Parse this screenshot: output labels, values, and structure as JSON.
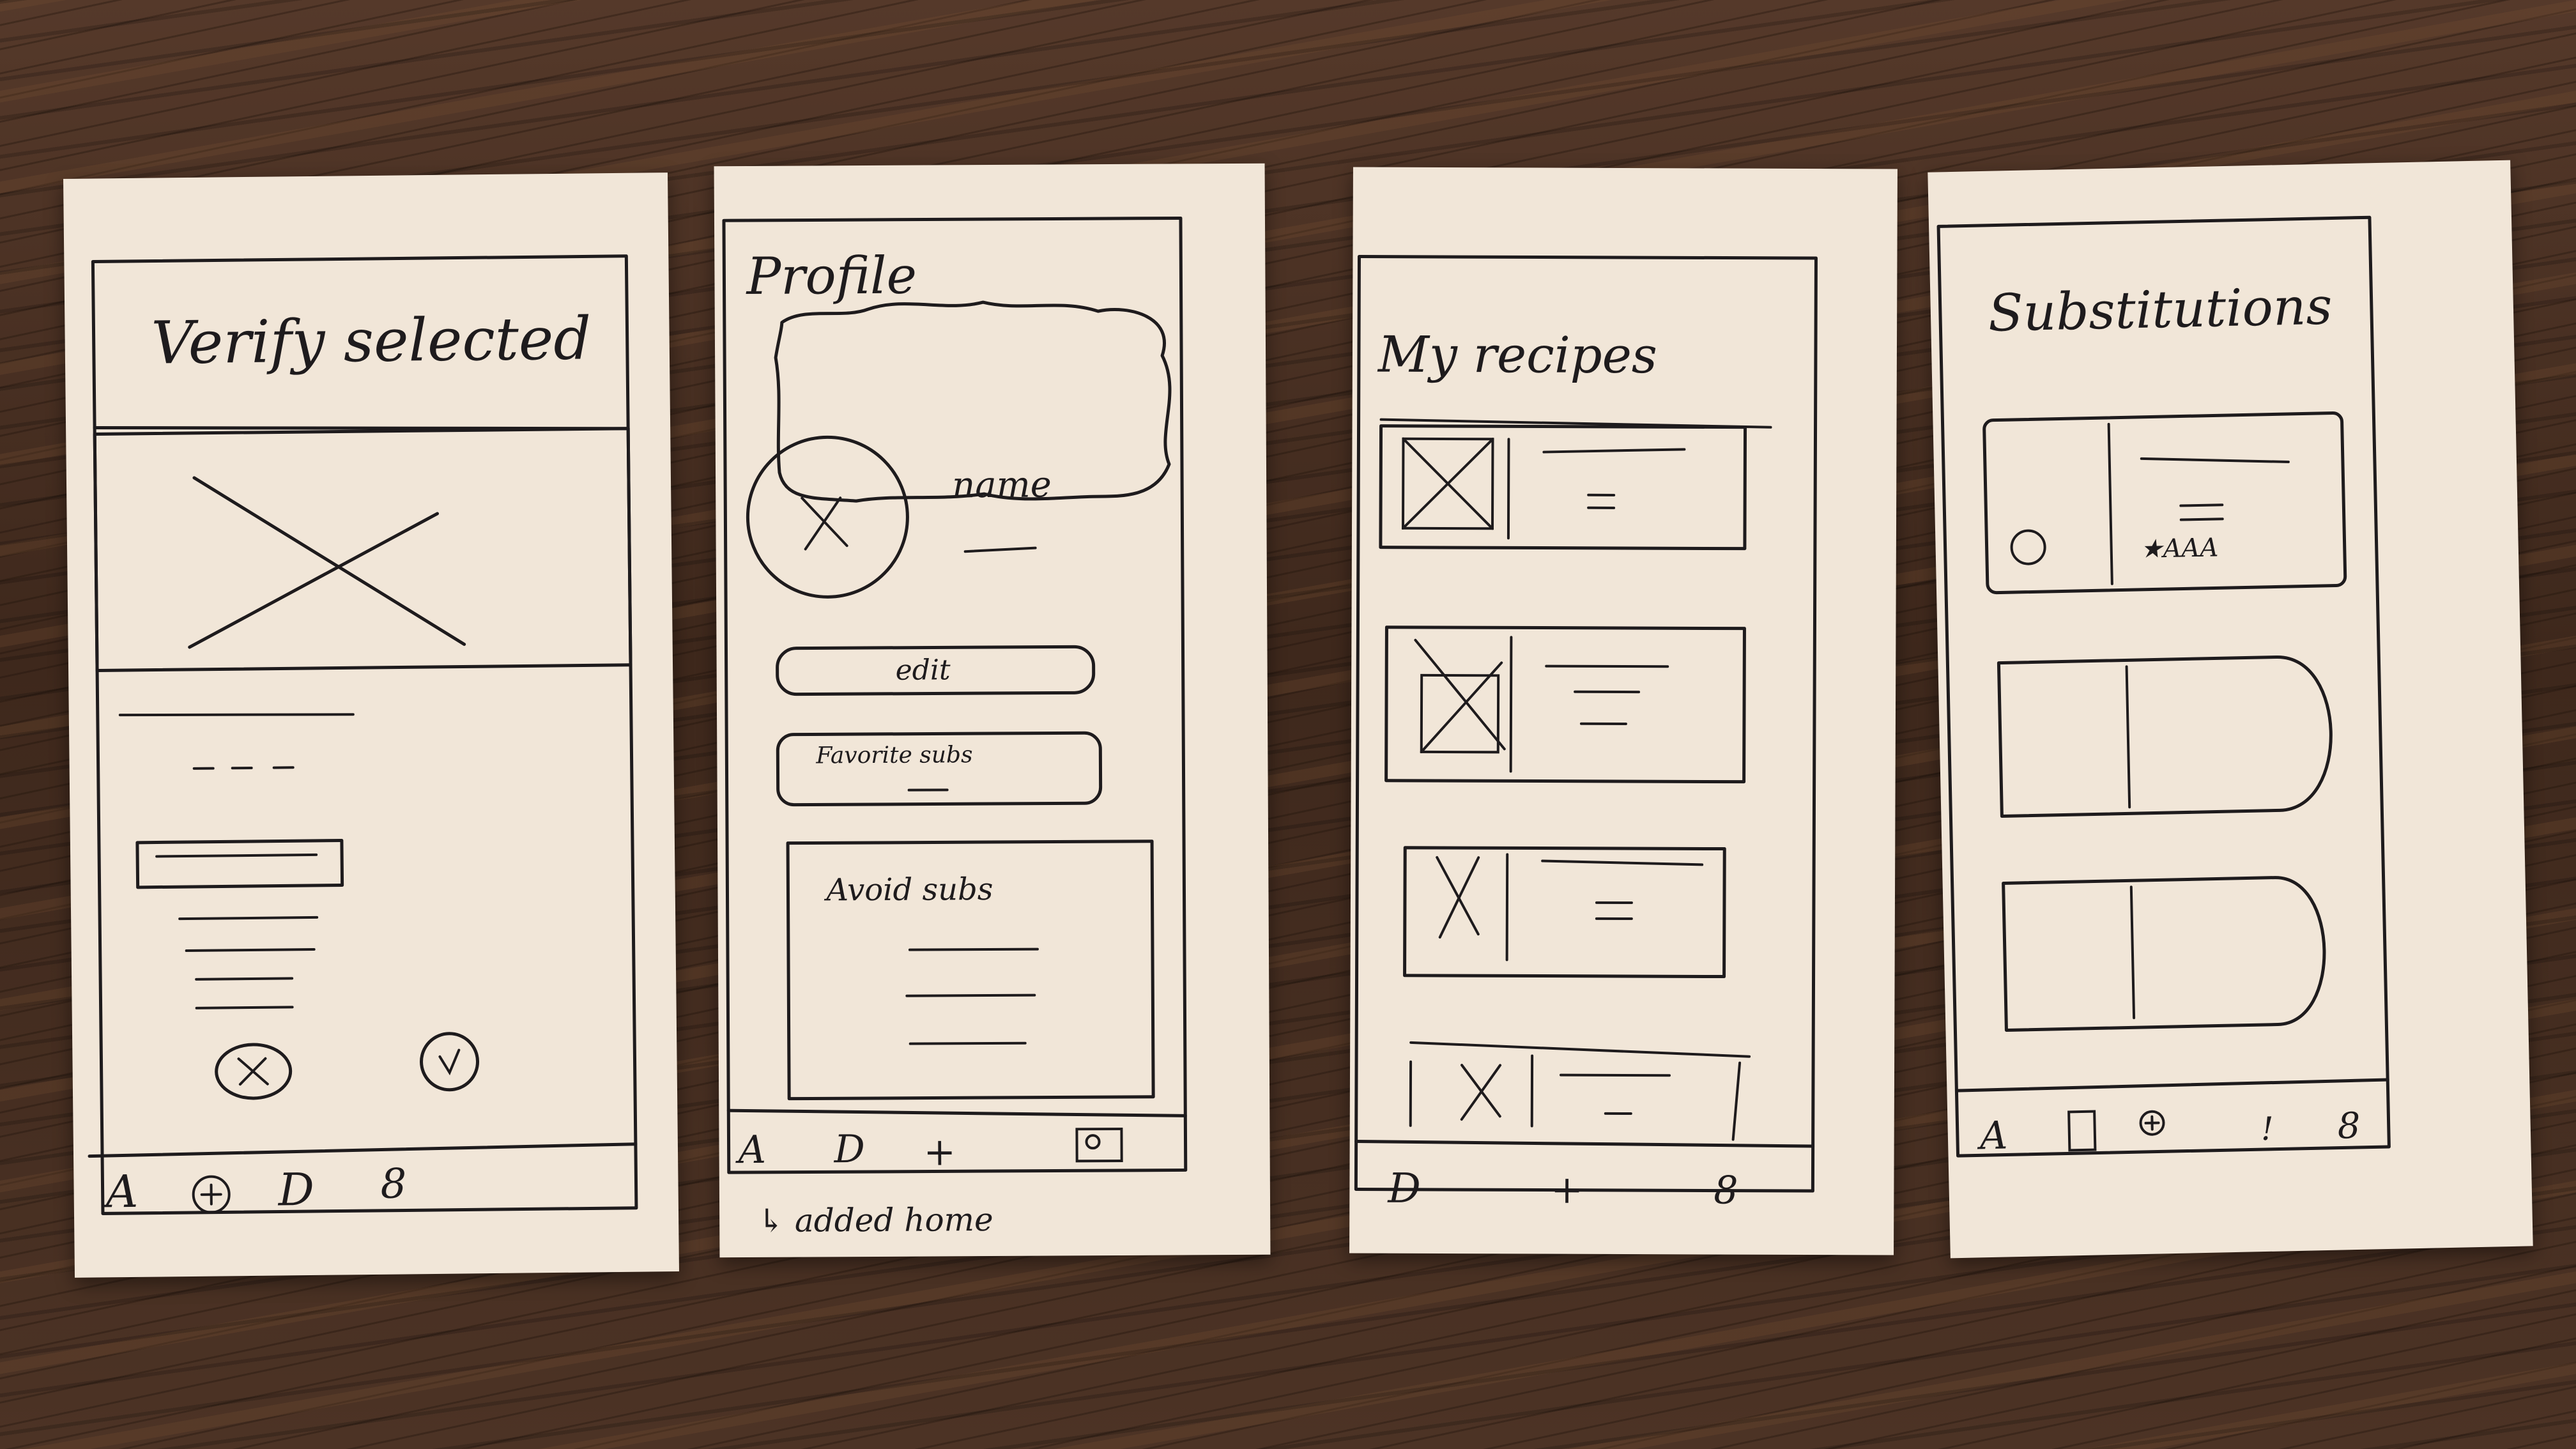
{
  "sketches": [
    {
      "title": "Verify selected",
      "bottom_nav": [
        "A",
        "+",
        "D",
        "8"
      ]
    },
    {
      "title": "Profile",
      "name_label": "name",
      "edit_label": "edit",
      "favorite_label": "Favorite subs",
      "avoid_label": "Avoid subs",
      "bottom_nav": [
        "A",
        "D",
        "+",
        ""
      ],
      "caption": "↳ added home"
    },
    {
      "title": "My recipes",
      "bottom_nav": [
        "D",
        "+",
        "8"
      ]
    },
    {
      "title": "Substitutions",
      "rating_text": "★AAA",
      "bottom_nav": [
        "A",
        "",
        "+",
        "!",
        "8"
      ]
    }
  ]
}
